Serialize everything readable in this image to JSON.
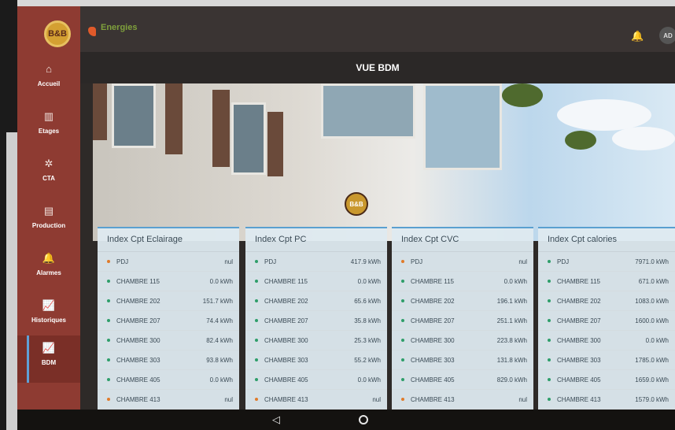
{
  "header": {
    "brand_text": "Energies",
    "title": "VUE BDM",
    "avatar_initials": "AD"
  },
  "sidebar": {
    "logo_text": "B&B",
    "items": [
      {
        "label": "Accueil",
        "icon": "home-icon",
        "glyph": "⌂"
      },
      {
        "label": "Etages",
        "icon": "building-icon",
        "glyph": "▥"
      },
      {
        "label": "CTA",
        "icon": "fan-icon",
        "glyph": "✲"
      },
      {
        "label": "Production",
        "icon": "meter-icon",
        "glyph": "▤"
      },
      {
        "label": "Alarmes",
        "icon": "bell-icon",
        "glyph": "🔔"
      },
      {
        "label": "Historiques",
        "icon": "chart-line-icon",
        "glyph": "📈"
      },
      {
        "label": "BDM",
        "icon": "chart-line-icon",
        "glyph": "📈"
      }
    ]
  },
  "colors": {
    "sidebar": "#8e3b32",
    "accent": "#5aa0d0",
    "dot_green": "#2e9e6a",
    "dot_orange": "#e07b2a"
  },
  "cards": [
    {
      "title": "Index Cpt Eclairage",
      "rows": [
        {
          "name": "PDJ",
          "value": "nul",
          "status": "orange"
        },
        {
          "name": "CHAMBRE 115",
          "value": "0.0 kWh",
          "status": "green"
        },
        {
          "name": "CHAMBRE 202",
          "value": "151.7 kWh",
          "status": "green"
        },
        {
          "name": "CHAMBRE 207",
          "value": "74.4 kWh",
          "status": "green"
        },
        {
          "name": "CHAMBRE 300",
          "value": "82.4 kWh",
          "status": "green"
        },
        {
          "name": "CHAMBRE 303",
          "value": "93.8 kWh",
          "status": "green"
        },
        {
          "name": "CHAMBRE 405",
          "value": "0.0 kWh",
          "status": "green"
        },
        {
          "name": "CHAMBRE 413",
          "value": "nul",
          "status": "orange"
        }
      ]
    },
    {
      "title": "Index Cpt PC",
      "rows": [
        {
          "name": "PDJ",
          "value": "417.9 kWh",
          "status": "green"
        },
        {
          "name": "CHAMBRE 115",
          "value": "0.0 kWh",
          "status": "green"
        },
        {
          "name": "CHAMBRE 202",
          "value": "65.6 kWh",
          "status": "green"
        },
        {
          "name": "CHAMBRE 207",
          "value": "35.8 kWh",
          "status": "green"
        },
        {
          "name": "CHAMBRE 300",
          "value": "25.3 kWh",
          "status": "green"
        },
        {
          "name": "CHAMBRE 303",
          "value": "55.2 kWh",
          "status": "green"
        },
        {
          "name": "CHAMBRE 405",
          "value": "0.0 kWh",
          "status": "green"
        },
        {
          "name": "CHAMBRE 413",
          "value": "nul",
          "status": "orange"
        }
      ]
    },
    {
      "title": "Index Cpt CVC",
      "rows": [
        {
          "name": "PDJ",
          "value": "nul",
          "status": "orange"
        },
        {
          "name": "CHAMBRE 115",
          "value": "0.0 kWh",
          "status": "green"
        },
        {
          "name": "CHAMBRE 202",
          "value": "196.1 kWh",
          "status": "green"
        },
        {
          "name": "CHAMBRE 207",
          "value": "251.1 kWh",
          "status": "green"
        },
        {
          "name": "CHAMBRE 300",
          "value": "223.8 kWh",
          "status": "green"
        },
        {
          "name": "CHAMBRE 303",
          "value": "131.8 kWh",
          "status": "green"
        },
        {
          "name": "CHAMBRE 405",
          "value": "829.0 kWh",
          "status": "green"
        },
        {
          "name": "CHAMBRE 413",
          "value": "nul",
          "status": "orange"
        }
      ]
    },
    {
      "title": "Index Cpt calories",
      "rows": [
        {
          "name": "PDJ",
          "value": "7971.0 kWh",
          "status": "green"
        },
        {
          "name": "CHAMBRE 115",
          "value": "671.0 kWh",
          "status": "green"
        },
        {
          "name": "CHAMBRE 202",
          "value": "1083.0 kWh",
          "status": "green"
        },
        {
          "name": "CHAMBRE 207",
          "value": "1600.0 kWh",
          "status": "green"
        },
        {
          "name": "CHAMBRE 300",
          "value": "0.0 kWh",
          "status": "green"
        },
        {
          "name": "CHAMBRE 303",
          "value": "1785.0 kWh",
          "status": "green"
        },
        {
          "name": "CHAMBRE 405",
          "value": "1659.0 kWh",
          "status": "green"
        },
        {
          "name": "CHAMBRE 413",
          "value": "1579.0 kWh",
          "status": "green"
        }
      ]
    }
  ]
}
